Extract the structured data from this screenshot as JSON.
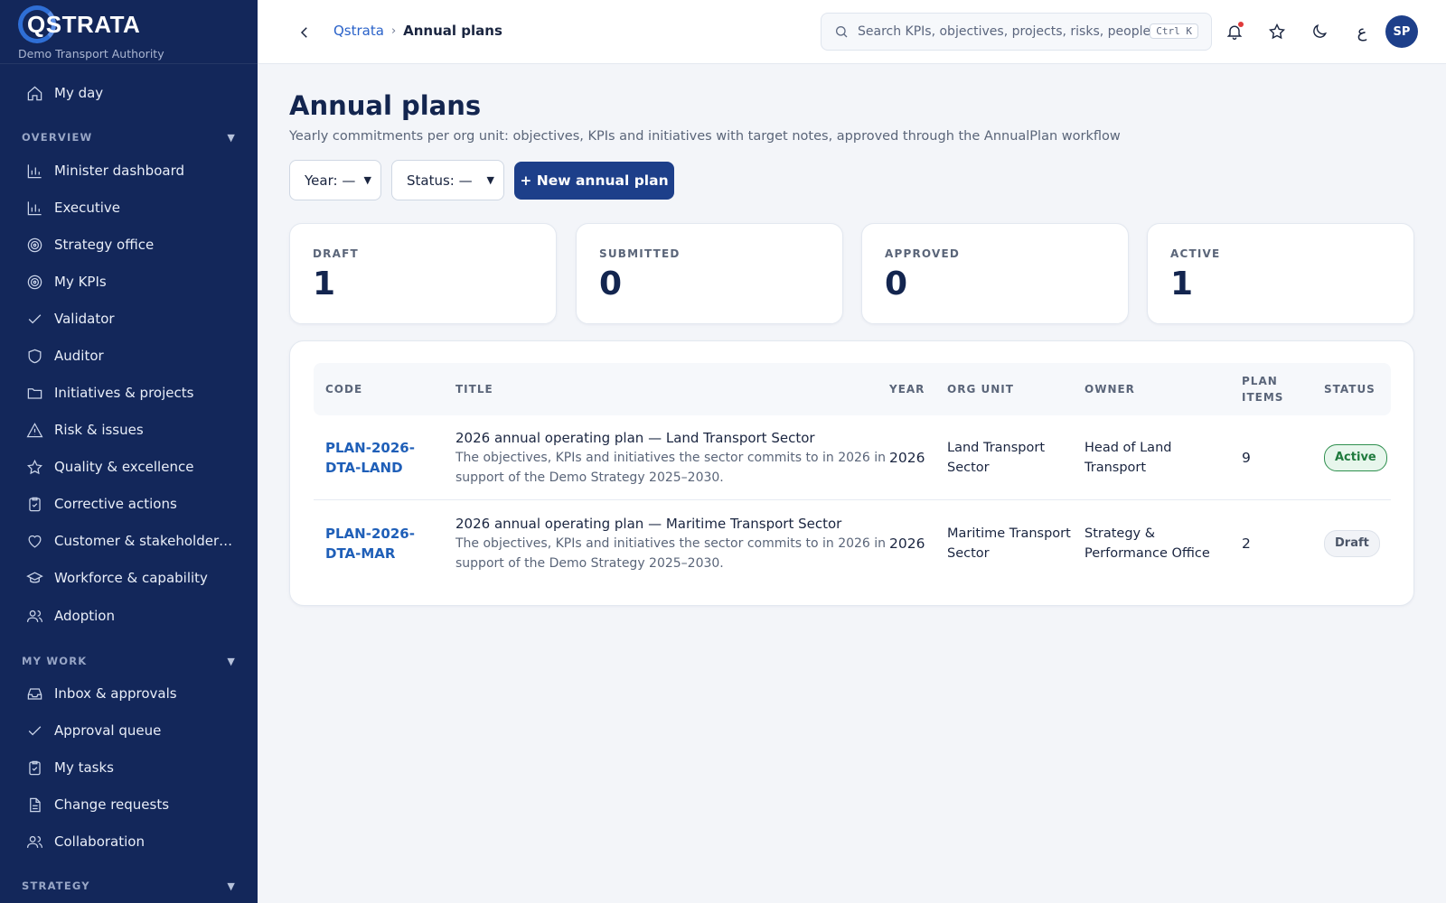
{
  "brand": {
    "logo_text": "QSTRATA",
    "org": "Demo Transport Authority"
  },
  "sidebar": {
    "top_items": [
      {
        "label": "My day",
        "icon": "home-icon"
      }
    ],
    "sections": [
      {
        "label": "OVERVIEW",
        "items": [
          {
            "label": "Minister dashboard",
            "icon": "bar-chart-icon"
          },
          {
            "label": "Executive",
            "icon": "bar-chart-icon"
          },
          {
            "label": "Strategy office",
            "icon": "target-icon"
          },
          {
            "label": "My KPIs",
            "icon": "target-icon"
          },
          {
            "label": "Validator",
            "icon": "check-icon"
          },
          {
            "label": "Auditor",
            "icon": "shield-icon"
          },
          {
            "label": "Initiatives & projects",
            "icon": "folder-icon"
          },
          {
            "label": "Risk & issues",
            "icon": "warning-icon"
          },
          {
            "label": "Quality & excellence",
            "icon": "star-icon"
          },
          {
            "label": "Corrective actions",
            "icon": "clipboard-check-icon"
          },
          {
            "label": "Customer & stakeholder e...",
            "icon": "heart-icon"
          },
          {
            "label": "Workforce & capability",
            "icon": "graduation-cap-icon"
          },
          {
            "label": "Adoption",
            "icon": "users-icon"
          }
        ]
      },
      {
        "label": "MY WORK",
        "items": [
          {
            "label": "Inbox & approvals",
            "icon": "inbox-icon"
          },
          {
            "label": "Approval queue",
            "icon": "check-icon"
          },
          {
            "label": "My tasks",
            "icon": "clipboard-check-icon"
          },
          {
            "label": "Change requests",
            "icon": "document-icon"
          },
          {
            "label": "Collaboration",
            "icon": "users-icon"
          }
        ]
      },
      {
        "label": "STRATEGY",
        "items": []
      }
    ]
  },
  "topbar": {
    "breadcrumb_root": "Qstrata",
    "breadcrumb_sep": "›",
    "breadcrumb_current": "Annual plans",
    "search_placeholder": "Search KPIs, objectives, projects, risks, people...",
    "search_shortcut": "Ctrl K",
    "lang_toggle": "ع",
    "avatar_initials": "SP"
  },
  "page": {
    "title": "Annual plans",
    "subtitle": "Yearly commitments per org unit: objectives, KPIs and initiatives with target notes, approved through the AnnualPlan workflow",
    "filters": {
      "year": "Year: —",
      "status": "Status: —"
    },
    "new_button": "+ New annual plan"
  },
  "stats": [
    {
      "label": "DRAFT",
      "value": "1"
    },
    {
      "label": "SUBMITTED",
      "value": "0"
    },
    {
      "label": "APPROVED",
      "value": "0"
    },
    {
      "label": "ACTIVE",
      "value": "1"
    }
  ],
  "table": {
    "headers": {
      "code": "CODE",
      "title": "TITLE",
      "year": "YEAR",
      "org_unit": "ORG UNIT",
      "owner": "OWNER",
      "plan_items_1": "PLAN",
      "plan_items_2": "ITEMS",
      "status": "STATUS"
    },
    "rows": [
      {
        "code_1": "PLAN-2026-",
        "code_2": "DTA-LAND",
        "title": "2026 annual operating plan — Land Transport Sector",
        "desc_1": "The objectives, KPIs and initiatives the sector commits to in 2026 in",
        "desc_2": "support of the Demo Strategy 2025–2030.",
        "year": "2026",
        "org_1": "Land Transport",
        "org_2": "Sector",
        "owner_1": "Head of Land",
        "owner_2": "Transport",
        "items": "9",
        "status": "Active"
      },
      {
        "code_1": "PLAN-2026-",
        "code_2": "DTA-MAR",
        "title": "2026 annual operating plan — Maritime Transport Sector",
        "desc_1": "The objectives, KPIs and initiatives the sector commits to in 2026 in",
        "desc_2": "support of the Demo Strategy 2025–2030.",
        "year": "2026",
        "org_1": "Maritime Transport",
        "org_2": "Sector",
        "owner_1": "Strategy &",
        "owner_2": "Performance Office",
        "items": "2",
        "status": "Draft"
      }
    ]
  }
}
